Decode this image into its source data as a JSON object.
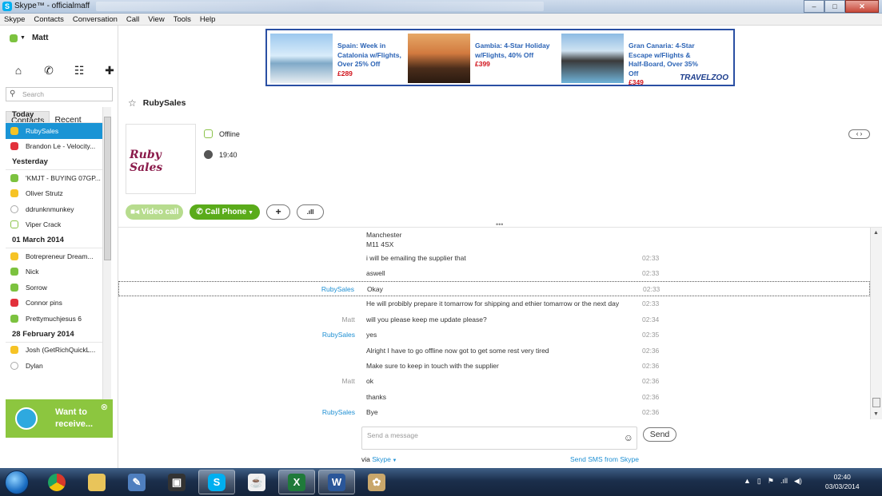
{
  "window": {
    "title": "Skype™ - officialmaff"
  },
  "menu": [
    "Skype",
    "Contacts",
    "Conversation",
    "Call",
    "View",
    "Tools",
    "Help"
  ],
  "user": {
    "name": "Matt",
    "status_color": "#7cc23f"
  },
  "nav_icons": [
    "home-icon",
    "phone-icon",
    "contacts-group-icon",
    "add-contact-icon"
  ],
  "search": {
    "placeholder": "Search"
  },
  "tabs": [
    "Contacts",
    "Recent"
  ],
  "contact_groups": [
    {
      "label": "Today",
      "contacts": [
        {
          "name": "RubySales",
          "status": "offline",
          "selected": true
        },
        {
          "name": "Brandon Le - Velocity...",
          "status": "dnd"
        }
      ]
    },
    {
      "label": "Yesterday",
      "contacts": [
        {
          "name": "'KMJT - BUYING 07GP...",
          "status": "online"
        },
        {
          "name": "Oliver Strutz",
          "status": "away"
        },
        {
          "name": "ddrunknmunkey",
          "status": "unknown"
        },
        {
          "name": "Viper Crack",
          "status": "offline"
        }
      ]
    },
    {
      "label": "01 March 2014",
      "contacts": [
        {
          "name": "Botrepreneur Dream...",
          "status": "away"
        },
        {
          "name": "Nick",
          "status": "online"
        },
        {
          "name": "Sorrow",
          "status": "online"
        },
        {
          "name": "Connor pins",
          "status": "dnd"
        },
        {
          "name": "Prettymuchjesus 6",
          "status": "online"
        }
      ]
    },
    {
      "label": "28 February 2014",
      "contacts": [
        {
          "name": "Josh (GetRichQuickL...",
          "status": "away"
        },
        {
          "name": "Dylan",
          "status": "unknown"
        }
      ]
    }
  ],
  "promo": {
    "line1": "Want to",
    "line2": "receive..."
  },
  "ads": [
    {
      "text": "Spain: Week in Catalonia w/Flights, Over 25% Off",
      "price": "£289"
    },
    {
      "text": "Gambia: 4-Star Holiday w/Flights, 40% Off",
      "price": "£399"
    },
    {
      "text": "Gran Canaria: 4-Star Escape w/Flights & Half-Board, Over 35% Off",
      "price": "£349"
    }
  ],
  "ad_brand": "TRAVELZOO",
  "conversation": {
    "name": "RubySales",
    "profile_logo": "Ruby Sales",
    "status": "Offline",
    "local_time": "19:40",
    "buttons": {
      "video": "Video call",
      "call": "Call Phone",
      "add": "+"
    }
  },
  "messages": [
    {
      "from": "",
      "text": "Manchester",
      "time": ""
    },
    {
      "from": "",
      "text": "M11 4SX",
      "time": ""
    },
    {
      "from": "",
      "text": "i will be emailing the supplier that",
      "time": "02:33"
    },
    {
      "from": "",
      "text": "aswell",
      "time": "02:33"
    },
    {
      "from": "RubySales",
      "text": "Okay",
      "time": "02:33",
      "focused": true
    },
    {
      "from": "",
      "text": "He will probibly prepare it tomarrow for shipping and ethier tomarrow or the next day",
      "time": "02:33"
    },
    {
      "from": "Matt",
      "text": "will you please keep me update please?",
      "time": "02:34"
    },
    {
      "from": "RubySales",
      "text": "yes",
      "time": "02:35"
    },
    {
      "from": "",
      "text": "Alright I have to go offline now got to get some rest very tired",
      "time": "02:36"
    },
    {
      "from": "",
      "text": "Make sure to keep in touch with the supplier",
      "time": "02:36"
    },
    {
      "from": "Matt",
      "text": "ok",
      "time": "02:36"
    },
    {
      "from": "",
      "text": "thanks",
      "time": "02:36"
    },
    {
      "from": "RubySales",
      "text": "Bye",
      "time": "02:36"
    }
  ],
  "composer": {
    "placeholder": "Send a message",
    "send": "Send",
    "via_label": "via",
    "via_link": "Skype",
    "sms_link": "Send SMS from Skype"
  },
  "taskbar": {
    "clock_time": "02:40",
    "clock_date": "03/03/2014"
  },
  "colors": {
    "skype_blue": "#00aff0",
    "selected_row": "#1a94d5",
    "call_green": "#5aab1a",
    "promo_green": "#8cc63f"
  }
}
